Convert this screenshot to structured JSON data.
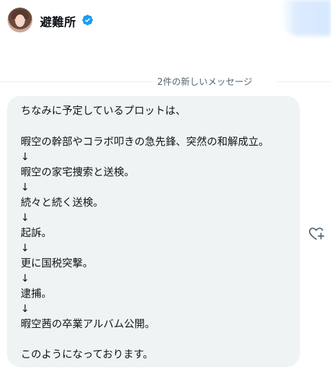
{
  "header": {
    "name": "避難所",
    "verified_icon": "verified-badge-icon",
    "accent": "#1d9bf0"
  },
  "divider": {
    "label": "2件の新しいメッセージ"
  },
  "message": {
    "lines": [
      "ちなみに予定しているプロットは、",
      "",
      "暇空の幹部やコラボ叩きの急先鋒、突然の和解成立。",
      "↓",
      "暇空の家宅捜索と送検。",
      "↓",
      "続々と続く送検。",
      "↓",
      "起訴。",
      "↓",
      "更に国税突撃。",
      "↓",
      "逮捕。",
      "↓",
      "暇空茜の卒業アルバム公開。",
      "",
      "このようになっております。"
    ],
    "bubble_color": "#eff3f4"
  },
  "actions": {
    "react_icon": "heart-plus-icon"
  }
}
